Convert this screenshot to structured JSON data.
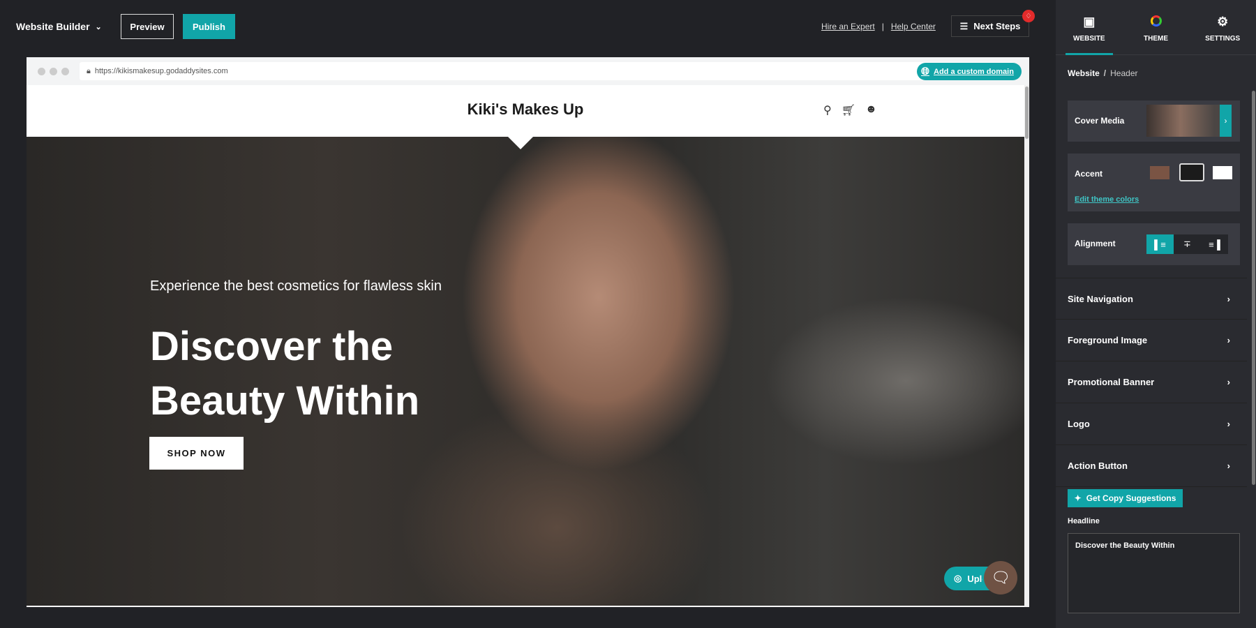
{
  "topbar": {
    "title": "Website Builder",
    "preview": "Preview",
    "publish": "Publish",
    "hire": "Hire an Expert",
    "sep": "|",
    "help": "Help Center",
    "next_steps": "Next Steps"
  },
  "browser": {
    "url": "https://kikismakesup.godaddysites.com",
    "domain_btn": "Add a custom domain"
  },
  "site": {
    "logo": "Kiki's Makes Up",
    "subtitle": "Experience the best cosmetics for flawless skin",
    "headline": "Discover the Beauty Within",
    "cta": "SHOP NOW",
    "upload": "Upload"
  },
  "panel": {
    "tabs": [
      {
        "label": "WEBSITE",
        "icon": "browser-window-icon",
        "active": true
      },
      {
        "label": "THEME",
        "icon": "color-wheel-icon"
      },
      {
        "label": "SETTINGS",
        "icon": "gear-icon"
      }
    ],
    "breadcrumb": {
      "root": "Website",
      "sep": "/",
      "current": "Header"
    },
    "cover_media": "Cover Media",
    "accent": {
      "label": "Accent",
      "colors": [
        "#7a5444",
        "#1b1b1b",
        "#ffffff"
      ],
      "selected": "#1b1b1b",
      "edit": "Edit theme colors"
    },
    "alignment": {
      "label": "Alignment",
      "selected": "left"
    },
    "sections": [
      "Site Navigation",
      "Foreground Image",
      "Promotional Banner",
      "Logo",
      "Action Button"
    ],
    "copy_btn": "Get Copy Suggestions",
    "headline_label": "Headline",
    "headline_value": "Discover the Beauty Within"
  },
  "colors": {
    "accent": "#11a5a8",
    "badge": "#e32b2b"
  }
}
